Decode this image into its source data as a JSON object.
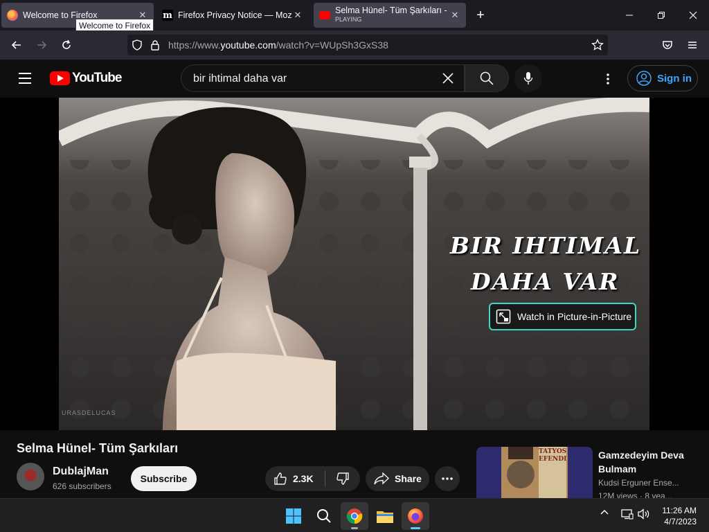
{
  "browser": {
    "tabs": [
      {
        "title": "Welcome to Firefox",
        "active": false
      },
      {
        "title": "Firefox Privacy Notice — Mozilla",
        "active": false
      },
      {
        "title": "Selma Hünel- Tüm Şarkıları - YouTube",
        "status": "PLAYING",
        "active": true
      }
    ],
    "tooltip": "Welcome to Firefox",
    "url_prefix": "https://www.",
    "url_domain": "youtube.com",
    "url_path": "/watch?v=WUpSh3GxS38"
  },
  "youtube": {
    "logo_text": "YouTube",
    "search_query": "bir ihtimal daha var",
    "sign_in_label": "Sign in",
    "video": {
      "overlay_line1": "BIR IHTIMAL",
      "overlay_line2": "DAHA VAR",
      "pip_label": "Watch in Picture-in-Picture",
      "watermark": "URASDELUCAS",
      "title": "Selma Hünel- Tüm Şarkıları",
      "channel": "DublajMan",
      "subscribers": "626 subscribers",
      "subscribe_label": "Subscribe",
      "likes": "2.3K",
      "share_label": "Share"
    },
    "recommendation": {
      "title": "Gamzedeyim Deva Bulmam",
      "channel": "Kudsi Erguner Ense...",
      "meta": "12M views · 8 yea...",
      "thumb_text_line1": "TATYOS",
      "thumb_text_line2": "EFENDI"
    }
  },
  "taskbar": {
    "time": "11:26 AM",
    "date": "4/7/2023"
  },
  "colors": {
    "firefox_bg": "#1c1b22",
    "youtube_red": "#ff0000",
    "signin_blue": "#3ea6ff",
    "pip_border": "#41d6c3"
  }
}
